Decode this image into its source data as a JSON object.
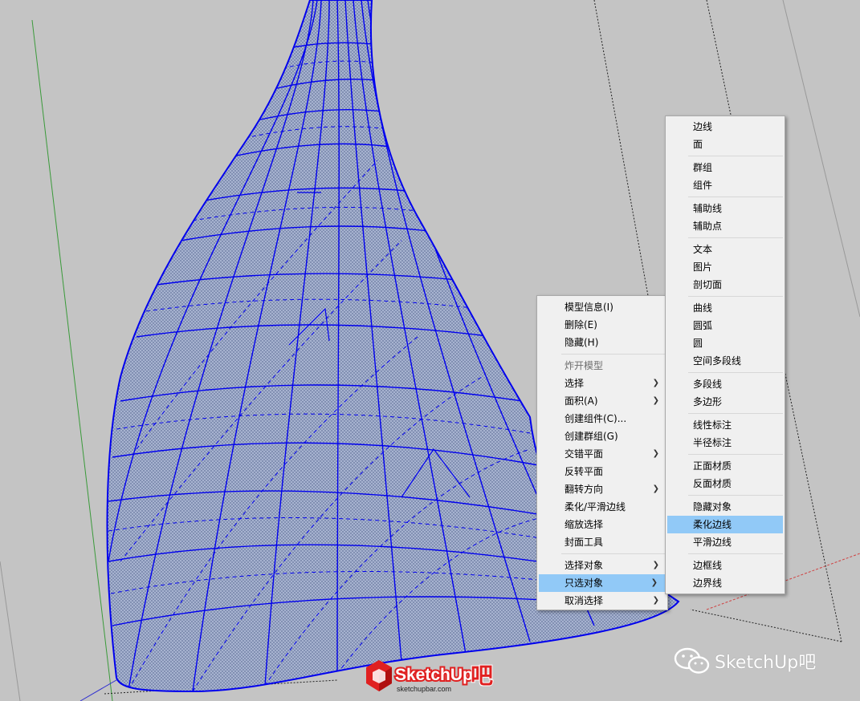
{
  "context_menu": {
    "items": [
      {
        "label": "模型信息(I)"
      },
      {
        "label": "删除(E)"
      },
      {
        "label": "隐藏(H)"
      },
      {
        "separator": true
      },
      {
        "label": "炸开模型",
        "disabled": true
      },
      {
        "label": "选择",
        "submenu": true
      },
      {
        "label": "面积(A)",
        "submenu": true
      },
      {
        "label": "创建组件(C)..."
      },
      {
        "label": "创建群组(G)"
      },
      {
        "label": "交错平面",
        "submenu": true
      },
      {
        "label": "反转平面"
      },
      {
        "label": "翻转方向",
        "submenu": true
      },
      {
        "label": "柔化/平滑边线"
      },
      {
        "label": "缩放选择"
      },
      {
        "label": "封面工具"
      },
      {
        "separator": true
      },
      {
        "label": "选择对象",
        "submenu": true
      },
      {
        "label": "只选对象",
        "submenu": true,
        "highlighted": true
      },
      {
        "label": "取消选择",
        "submenu": true
      }
    ]
  },
  "submenu": {
    "items": [
      {
        "label": "边线"
      },
      {
        "label": "面"
      },
      {
        "separator": true
      },
      {
        "label": "群组"
      },
      {
        "label": "组件"
      },
      {
        "separator": true
      },
      {
        "label": "辅助线"
      },
      {
        "label": "辅助点"
      },
      {
        "separator": true
      },
      {
        "label": "文本"
      },
      {
        "label": "图片"
      },
      {
        "label": "剖切面"
      },
      {
        "separator": true
      },
      {
        "label": "曲线"
      },
      {
        "label": "圆弧"
      },
      {
        "label": "圆"
      },
      {
        "label": "空间多段线"
      },
      {
        "separator": true
      },
      {
        "label": "多段线"
      },
      {
        "label": "多边形"
      },
      {
        "separator": true
      },
      {
        "label": "线性标注"
      },
      {
        "label": "半径标注"
      },
      {
        "separator": true
      },
      {
        "label": "正面材质"
      },
      {
        "label": "反面材质"
      },
      {
        "separator": true
      },
      {
        "label": "隐藏对象"
      },
      {
        "label": "柔化边线",
        "highlighted": true
      },
      {
        "label": "平滑边线"
      },
      {
        "separator": true
      },
      {
        "label": "边框线"
      },
      {
        "label": "边界线"
      }
    ]
  },
  "watermark": {
    "logo_text": "SketchUp",
    "logo_suffix": "吧",
    "logo_url": "sketchupbar.com",
    "wechat_text": "SketchUp吧"
  },
  "colors": {
    "viewport_bg": "#c4c4c4",
    "model_fill": "#a7b3d0",
    "edge_selected": "#0000ee",
    "highlight": "#91c9f7",
    "axis_green": "#3a9a3a",
    "axis_red": "#d04040",
    "logo_red": "#e02020"
  }
}
